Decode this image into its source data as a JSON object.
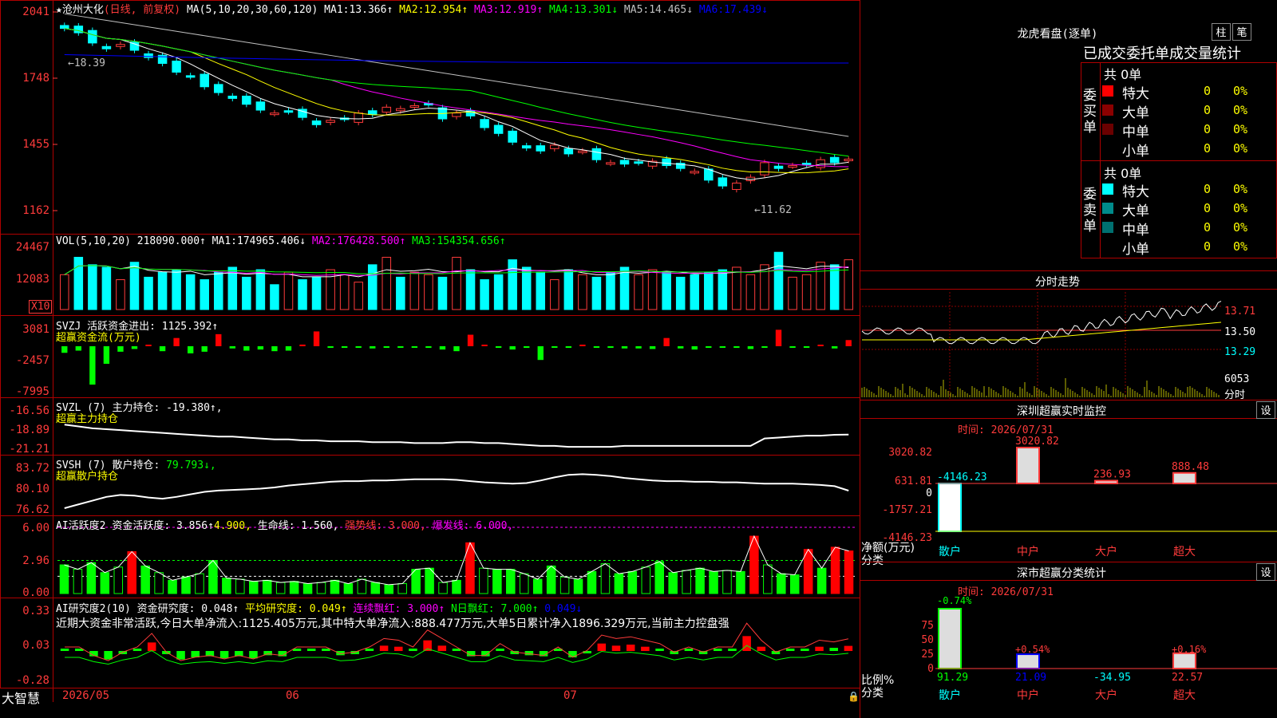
{
  "app": {
    "brand": "大智慧"
  },
  "main_chart": {
    "title": "★沧州大化",
    "period": "(日线, 前复权)",
    "ma_label": "MA(5,10,20,30,60,120)",
    "ma": [
      {
        "label": "MA1:",
        "value": "13.366↑",
        "color": "#ffffff"
      },
      {
        "label": "MA2:",
        "value": "12.954↑",
        "color": "#ffff00"
      },
      {
        "label": "MA3:",
        "value": "12.919↑",
        "color": "#ff00ff"
      },
      {
        "label": "MA4:",
        "value": "13.301↓",
        "color": "#00ff00"
      },
      {
        "label": "MA5:",
        "value": "14.465↓",
        "color": "#c0c0c0"
      },
      {
        "label": "MA6:",
        "value": "17.439↓",
        "color": "#0000ff"
      }
    ],
    "y_ticks": [
      "2041",
      "1748",
      "1455",
      "1162"
    ],
    "high_marker": "←18.39",
    "low_marker": "←11.62"
  },
  "volume": {
    "title": "VOL(5,10,20)",
    "value": "218090.000↑",
    "ma": [
      {
        "label": "MA1:",
        "value": "174965.406↓",
        "color": "#ffffff"
      },
      {
        "label": "MA2:",
        "value": "176428.500↑",
        "color": "#ff00ff"
      },
      {
        "label": "MA3:",
        "value": "154354.656↑",
        "color": "#00ff00"
      }
    ],
    "y_ticks": [
      "24467",
      "12083"
    ],
    "unit": "X10"
  },
  "svzj": {
    "title": "SVZJ",
    "label": "活跃资金进出:",
    "value": "1125.392↑",
    "subtitle": "超赢资金流(万元)",
    "y_ticks": [
      "3081",
      "-2457",
      "-7995"
    ]
  },
  "svzl": {
    "title": "SVZL (7)",
    "label": "主力持仓:",
    "value": "-19.380↑,",
    "subtitle": "超赢主力持仓",
    "y_ticks": [
      "-16.56",
      "-18.89",
      "-21.21"
    ]
  },
  "svsh": {
    "title": "SVSH (7)",
    "label": "散户持仓:",
    "value": "79.793↓,",
    "subtitle": "超赢散户持仓",
    "y_ticks": [
      "83.72",
      "80.10",
      "76.62"
    ]
  },
  "ai_active": {
    "title": "AI活跃度2",
    "label": "资金活跃度:",
    "value": "3.856↑",
    "value2": "4.900,",
    "life_label": "生命线:",
    "life_value": "1.560,",
    "strong_label": "强势线:",
    "strong_value": "3.000,",
    "burst_label": "爆发线:",
    "burst_value": "6.000,",
    "y_ticks": [
      "6.00",
      "2.96",
      "0.00"
    ]
  },
  "ai_research": {
    "title": "AI研究度2(10)",
    "label": "资金研究度:",
    "value": "0.048↑",
    "avg_label": "平均研究度:",
    "avg_value": "0.049↑",
    "red_label": "连续飘红:",
    "red_value": "3.000↑",
    "nred_label": "N日飘红:",
    "nred_value": "7.000↑",
    "last_value": "0.049↓",
    "comment": "近期大资金非常活跃,今日大单净流入:1125.405万元,其中特大单净流入:888.477万元,大单5日累计净入1896.329万元,当前主力控盘强",
    "y_ticks": [
      "0.33",
      "0.03",
      "-0.28"
    ]
  },
  "x_axis": {
    "labels": [
      "2026/05",
      "06",
      "07"
    ]
  },
  "dragon_tiger": {
    "title": "龙虎看盘(逐单)",
    "btn_bar": "柱",
    "btn_pen": "笔",
    "header": "已成交委托单成交量统计",
    "buy": {
      "side_label": "委买单",
      "total": "共 0单",
      "rows": [
        {
          "name": "特大",
          "count": "0",
          "pct": "0%",
          "color": "#ff0000"
        },
        {
          "name": "大单",
          "count": "0",
          "pct": "0%",
          "color": "#8b0000"
        },
        {
          "name": "中单",
          "count": "0",
          "pct": "0%",
          "color": "#6b0000"
        },
        {
          "name": "小单",
          "count": "0",
          "pct": "0%",
          "color": "#000000"
        }
      ]
    },
    "sell": {
      "side_label": "委卖单",
      "total": "共 0单",
      "rows": [
        {
          "name": "特大",
          "count": "0",
          "pct": "0%",
          "color": "#00ffff"
        },
        {
          "name": "大单",
          "count": "0",
          "pct": "0%",
          "color": "#008b8b"
        },
        {
          "name": "中单",
          "count": "0",
          "pct": "0%",
          "color": "#007070"
        },
        {
          "name": "小单",
          "count": "0",
          "pct": "0%",
          "color": "#000000"
        }
      ]
    }
  },
  "intraday": {
    "title": "分时走势",
    "y_ticks": [
      "13.71",
      "13.50",
      "13.29"
    ],
    "vol_tick": "6053",
    "vol_unit": "分时"
  },
  "sz_monitor": {
    "title": "深圳超赢实时监控",
    "btn": "设",
    "time": "时间: 2026/07/31",
    "y_ticks": [
      "3020.82",
      "631.81",
      "0",
      "-1757.21",
      "-4146.23"
    ],
    "y_unit": "净额(万元)",
    "x_unit": "分类",
    "categories": [
      "散户",
      "中户",
      "大户",
      "超大"
    ],
    "values": [
      -4146.23,
      3020.82,
      236.93,
      888.48
    ],
    "value_labels": [
      "-4146.23",
      "3020.82",
      "236.93",
      "888.48"
    ]
  },
  "sz_category": {
    "title": "深市超赢分类统计",
    "btn": "设",
    "time": "时间: 2026/07/31",
    "y_ticks": [
      "75",
      "50",
      "25",
      "0"
    ],
    "y_unit": "比例%",
    "x_unit": "分类",
    "categories": [
      "散户",
      "中户",
      "大户",
      "超大"
    ],
    "top_labels": [
      "-0.74%",
      "+0.54%",
      "",
      "+0.16%"
    ],
    "bottom_labels": [
      "91.29",
      "21.09",
      "-34.95",
      "22.57"
    ],
    "bar_values": [
      91.29,
      21.09,
      0,
      22.57
    ]
  },
  "chart_data": [
    {
      "type": "candlestick",
      "title": "沧州大化 (日线, 前复权)",
      "ylim": [
        11.62,
        18.39
      ],
      "note_high": 18.39,
      "note_low": 11.62,
      "close": [
        18.1,
        17.95,
        17.6,
        17.4,
        17.55,
        17.35,
        17.1,
        16.9,
        16.6,
        16.45,
        16.1,
        15.9,
        15.7,
        15.5,
        15.3,
        15.2,
        15.25,
        15.05,
        14.8,
        14.95,
        15.0,
        15.2,
        15.15,
        15.4,
        15.35,
        15.45,
        15.5,
        15.0,
        15.2,
        15.1,
        14.7,
        14.5,
        14.2,
        14.0,
        13.9,
        14.1,
        13.8,
        13.9,
        13.6,
        13.5,
        13.45,
        13.5,
        13.55,
        13.4,
        13.3,
        13.2,
        12.9,
        12.7,
        12.8,
        13.0,
        13.5,
        13.3,
        13.4,
        13.45,
        13.6,
        13.5,
        13.62
      ]
    },
    {
      "type": "bar",
      "title": "VOL(5,10,20)",
      "values": [
        140,
        210,
        180,
        170,
        120,
        190,
        130,
        150,
        160,
        140,
        120,
        150,
        170,
        130,
        160,
        100,
        150,
        120,
        130,
        160,
        140,
        110,
        180,
        210,
        130,
        150,
        140,
        130,
        210,
        160,
        120,
        140,
        200,
        170,
        150,
        120,
        160,
        140,
        130,
        150,
        170,
        140,
        160,
        150,
        130,
        140,
        150,
        160,
        170,
        140,
        180,
        230,
        130,
        140,
        190,
        180,
        200
      ]
    },
    {
      "type": "bar",
      "title": "超赢资金流(万元)",
      "values": [
        -1200,
        -800,
        -7000,
        -3200,
        -1000,
        -500,
        200,
        -900,
        1500,
        -1300,
        -1000,
        2200,
        -400,
        -800,
        -600,
        -900,
        -800,
        300,
        2700,
        -300,
        -300,
        -200,
        -400,
        -200,
        -100,
        -100,
        -300,
        -600,
        -900,
        2100,
        200,
        -200,
        -600,
        -300,
        -2500,
        -200,
        -300,
        200,
        -100,
        -300,
        -400,
        -400,
        -500,
        1500,
        -400,
        -600,
        -200,
        -100,
        -300,
        -500,
        -200,
        3000,
        -200,
        -100,
        200,
        -400,
        1125
      ]
    },
    {
      "type": "line",
      "title": "超赢主力持仓",
      "y": [
        -18.3,
        -18.5,
        -18.7,
        -18.8,
        -18.9,
        -19.0,
        -19.1,
        -19.2,
        -19.3,
        -19.4,
        -19.5,
        -19.6,
        -19.6,
        -19.7,
        -19.8,
        -19.9,
        -19.9,
        -20.0,
        -20.0,
        -20.1,
        -20.1,
        -20.1,
        -20.2,
        -20.2,
        -20.2,
        -20.3,
        -20.3,
        -20.3,
        -20.2,
        -20.2,
        -20.3,
        -20.3,
        -20.4,
        -20.5,
        -20.6,
        -20.6,
        -20.7,
        -20.7,
        -20.7,
        -20.7,
        -20.6,
        -20.6,
        -20.6,
        -20.6,
        -20.6,
        -20.6,
        -20.6,
        -20.6,
        -20.6,
        -20.6,
        -19.8,
        -19.7,
        -19.6,
        -19.5,
        -19.5,
        -19.4,
        -19.38
      ]
    },
    {
      "type": "line",
      "title": "超赢散户持仓",
      "y": [
        77.0,
        77.6,
        78.2,
        78.8,
        79.1,
        79.0,
        78.7,
        78.5,
        78.8,
        79.2,
        79.6,
        79.8,
        79.9,
        80.0,
        80.1,
        80.3,
        80.6,
        80.8,
        81.0,
        81.2,
        81.3,
        81.3,
        81.4,
        81.4,
        81.5,
        81.6,
        81.6,
        81.6,
        81.5,
        81.3,
        81.1,
        81.0,
        80.9,
        81.0,
        81.4,
        81.9,
        82.3,
        82.4,
        82.3,
        82.1,
        81.8,
        81.6,
        81.4,
        81.3,
        81.3,
        81.2,
        81.2,
        81.1,
        81.1,
        81.0,
        80.9,
        80.9,
        80.9,
        80.8,
        80.7,
        80.5,
        79.79
      ]
    },
    {
      "type": "bar",
      "title": "AI活跃度2",
      "values": [
        2.6,
        2.2,
        2.8,
        1.9,
        2.4,
        3.8,
        2.5,
        1.9,
        1.2,
        1.5,
        1.8,
        3.0,
        1.4,
        1.3,
        1.1,
        1.2,
        1.0,
        1.1,
        0.9,
        1.0,
        1.2,
        0.9,
        1.3,
        1.0,
        0.8,
        0.9,
        2.2,
        2.3,
        1.0,
        1.2,
        4.6,
        2.3,
        2.2,
        2.2,
        1.8,
        1.3,
        2.5,
        1.5,
        1.3,
        2.0,
        2.7,
        1.8,
        2.0,
        2.4,
        2.9,
        1.9,
        2.1,
        2.3,
        2.0,
        2.1,
        2.0,
        5.2,
        2.6,
        1.8,
        1.7,
        4.0,
        2.3,
        4.2,
        3.86
      ]
    },
    {
      "type": "bar",
      "title": "AI研究度2(10)",
      "values": [
        0.0,
        0.0,
        -0.05,
        -0.08,
        -0.03,
        0.0,
        0.08,
        -0.03,
        -0.08,
        -0.06,
        -0.05,
        -0.07,
        -0.05,
        -0.07,
        -0.04,
        -0.05,
        0.0,
        0.0,
        0.0,
        -0.04,
        -0.03,
        0.0,
        0.05,
        0.04,
        0.0,
        0.1,
        0.05,
        0.0,
        -0.05,
        -0.05,
        0.02,
        -0.03,
        -0.04,
        -0.05,
        0.0,
        -0.06,
        -0.02,
        0.07,
        0.05,
        0.06,
        0.04,
        0.02,
        -0.03,
        0.0,
        -0.03,
        0.0,
        0.0,
        0.14,
        0.04,
        -0.03,
        0.0,
        0.0,
        0.04,
        0.03,
        0.048
      ]
    }
  ]
}
